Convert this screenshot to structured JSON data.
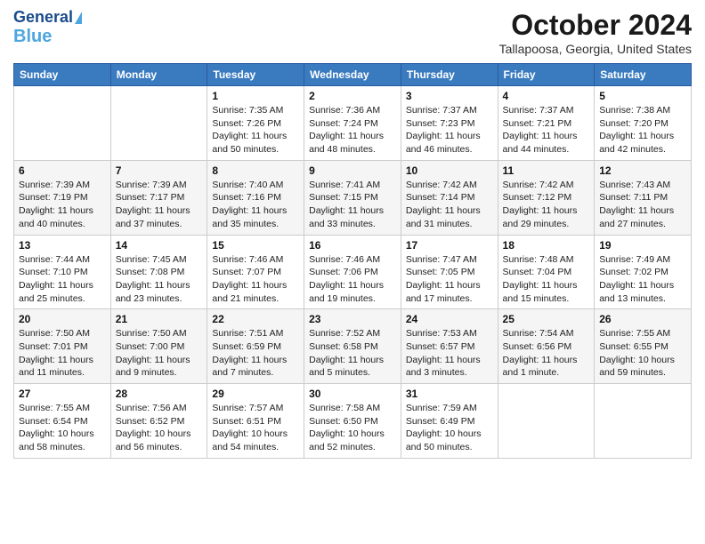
{
  "header": {
    "logo_line1": "General",
    "logo_line2": "Blue",
    "month_title": "October 2024",
    "location": "Tallapoosa, Georgia, United States"
  },
  "days_of_week": [
    "Sunday",
    "Monday",
    "Tuesday",
    "Wednesday",
    "Thursday",
    "Friday",
    "Saturday"
  ],
  "weeks": [
    [
      {
        "day": "",
        "info": ""
      },
      {
        "day": "",
        "info": ""
      },
      {
        "day": "1",
        "info": "Sunrise: 7:35 AM\nSunset: 7:26 PM\nDaylight: 11 hours and 50 minutes."
      },
      {
        "day": "2",
        "info": "Sunrise: 7:36 AM\nSunset: 7:24 PM\nDaylight: 11 hours and 48 minutes."
      },
      {
        "day": "3",
        "info": "Sunrise: 7:37 AM\nSunset: 7:23 PM\nDaylight: 11 hours and 46 minutes."
      },
      {
        "day": "4",
        "info": "Sunrise: 7:37 AM\nSunset: 7:21 PM\nDaylight: 11 hours and 44 minutes."
      },
      {
        "day": "5",
        "info": "Sunrise: 7:38 AM\nSunset: 7:20 PM\nDaylight: 11 hours and 42 minutes."
      }
    ],
    [
      {
        "day": "6",
        "info": "Sunrise: 7:39 AM\nSunset: 7:19 PM\nDaylight: 11 hours and 40 minutes."
      },
      {
        "day": "7",
        "info": "Sunrise: 7:39 AM\nSunset: 7:17 PM\nDaylight: 11 hours and 37 minutes."
      },
      {
        "day": "8",
        "info": "Sunrise: 7:40 AM\nSunset: 7:16 PM\nDaylight: 11 hours and 35 minutes."
      },
      {
        "day": "9",
        "info": "Sunrise: 7:41 AM\nSunset: 7:15 PM\nDaylight: 11 hours and 33 minutes."
      },
      {
        "day": "10",
        "info": "Sunrise: 7:42 AM\nSunset: 7:14 PM\nDaylight: 11 hours and 31 minutes."
      },
      {
        "day": "11",
        "info": "Sunrise: 7:42 AM\nSunset: 7:12 PM\nDaylight: 11 hours and 29 minutes."
      },
      {
        "day": "12",
        "info": "Sunrise: 7:43 AM\nSunset: 7:11 PM\nDaylight: 11 hours and 27 minutes."
      }
    ],
    [
      {
        "day": "13",
        "info": "Sunrise: 7:44 AM\nSunset: 7:10 PM\nDaylight: 11 hours and 25 minutes."
      },
      {
        "day": "14",
        "info": "Sunrise: 7:45 AM\nSunset: 7:08 PM\nDaylight: 11 hours and 23 minutes."
      },
      {
        "day": "15",
        "info": "Sunrise: 7:46 AM\nSunset: 7:07 PM\nDaylight: 11 hours and 21 minutes."
      },
      {
        "day": "16",
        "info": "Sunrise: 7:46 AM\nSunset: 7:06 PM\nDaylight: 11 hours and 19 minutes."
      },
      {
        "day": "17",
        "info": "Sunrise: 7:47 AM\nSunset: 7:05 PM\nDaylight: 11 hours and 17 minutes."
      },
      {
        "day": "18",
        "info": "Sunrise: 7:48 AM\nSunset: 7:04 PM\nDaylight: 11 hours and 15 minutes."
      },
      {
        "day": "19",
        "info": "Sunrise: 7:49 AM\nSunset: 7:02 PM\nDaylight: 11 hours and 13 minutes."
      }
    ],
    [
      {
        "day": "20",
        "info": "Sunrise: 7:50 AM\nSunset: 7:01 PM\nDaylight: 11 hours and 11 minutes."
      },
      {
        "day": "21",
        "info": "Sunrise: 7:50 AM\nSunset: 7:00 PM\nDaylight: 11 hours and 9 minutes."
      },
      {
        "day": "22",
        "info": "Sunrise: 7:51 AM\nSunset: 6:59 PM\nDaylight: 11 hours and 7 minutes."
      },
      {
        "day": "23",
        "info": "Sunrise: 7:52 AM\nSunset: 6:58 PM\nDaylight: 11 hours and 5 minutes."
      },
      {
        "day": "24",
        "info": "Sunrise: 7:53 AM\nSunset: 6:57 PM\nDaylight: 11 hours and 3 minutes."
      },
      {
        "day": "25",
        "info": "Sunrise: 7:54 AM\nSunset: 6:56 PM\nDaylight: 11 hours and 1 minute."
      },
      {
        "day": "26",
        "info": "Sunrise: 7:55 AM\nSunset: 6:55 PM\nDaylight: 10 hours and 59 minutes."
      }
    ],
    [
      {
        "day": "27",
        "info": "Sunrise: 7:55 AM\nSunset: 6:54 PM\nDaylight: 10 hours and 58 minutes."
      },
      {
        "day": "28",
        "info": "Sunrise: 7:56 AM\nSunset: 6:52 PM\nDaylight: 10 hours and 56 minutes."
      },
      {
        "day": "29",
        "info": "Sunrise: 7:57 AM\nSunset: 6:51 PM\nDaylight: 10 hours and 54 minutes."
      },
      {
        "day": "30",
        "info": "Sunrise: 7:58 AM\nSunset: 6:50 PM\nDaylight: 10 hours and 52 minutes."
      },
      {
        "day": "31",
        "info": "Sunrise: 7:59 AM\nSunset: 6:49 PM\nDaylight: 10 hours and 50 minutes."
      },
      {
        "day": "",
        "info": ""
      },
      {
        "day": "",
        "info": ""
      }
    ]
  ]
}
